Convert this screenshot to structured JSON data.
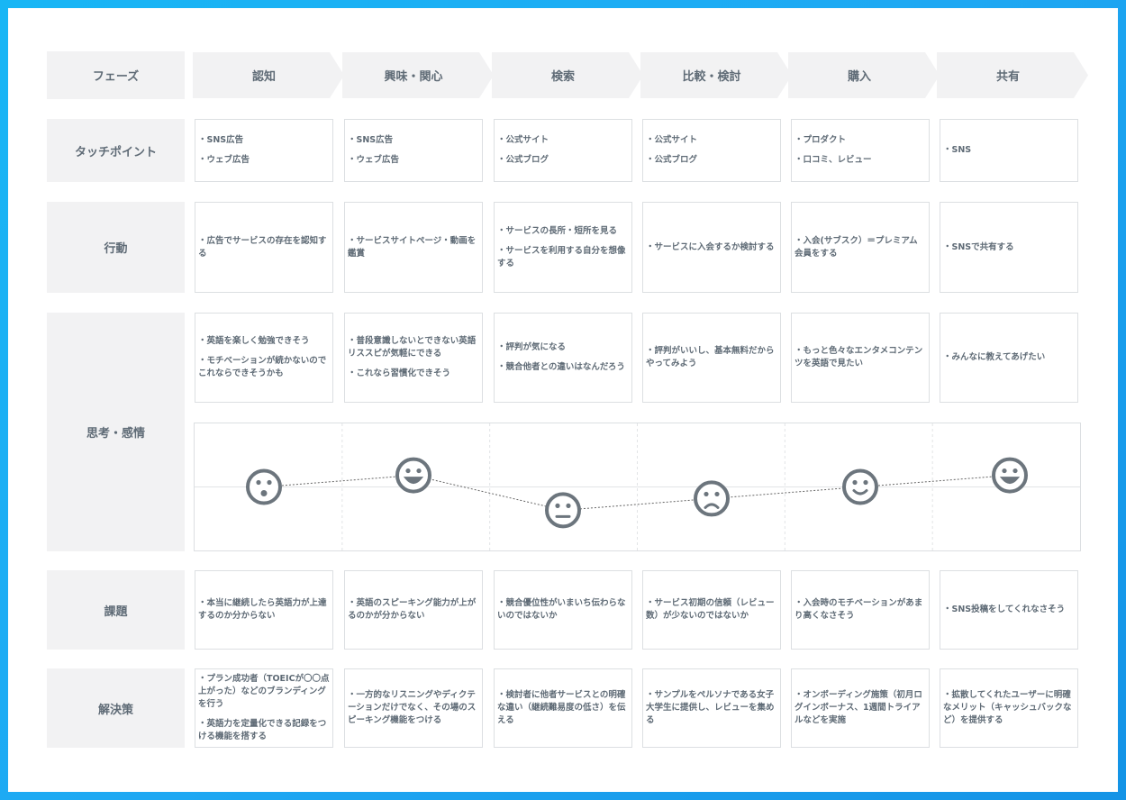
{
  "row_labels": {
    "phase": "フェーズ",
    "touchpoint": "タッチポイント",
    "action": "行動",
    "emotion": "思考・感情",
    "issue": "課題",
    "solution": "解決策"
  },
  "phases": [
    "認知",
    "興味・関心",
    "検索",
    "比較・検討",
    "購入",
    "共有"
  ],
  "touchpoints": [
    [
      "・SNS広告",
      "・ウェブ広告"
    ],
    [
      "・SNS広告",
      "・ウェブ広告"
    ],
    [
      "・公式サイト",
      "・公式ブログ"
    ],
    [
      "・公式サイト",
      "・公式ブログ"
    ],
    [
      "・プロダクト",
      "・口コミ、レビュー"
    ],
    [
      "・SNS"
    ]
  ],
  "actions": [
    [
      "・広告でサービスの存在を認知する"
    ],
    [
      "・サービスサイトページ・動画を鑑賞"
    ],
    [
      "・サービスの長所・短所を見る",
      "・サービスを利用する自分を想像する"
    ],
    [
      "・サービスに入会するか検討する"
    ],
    [
      "・入会(サブスク）＝プレミアム会員をする"
    ],
    [
      "・SNSで共有する"
    ]
  ],
  "thoughts": [
    [
      "・英語を楽しく勉強できそう",
      "・モチベーションが続かないのでこれならできそうかも"
    ],
    [
      "・普段意識しないとできない英語リススピが気軽にできる",
      "・これなら習慣化できそう"
    ],
    [
      "・評判が気になる",
      "・競合他者との違いはなんだろう"
    ],
    [
      "・評判がいいし、基本無料だからやってみよう"
    ],
    [
      "・もっと色々なエンタメコンテンツを英語で見たい"
    ],
    [
      "・みんなに教えてあげたい"
    ]
  ],
  "issues": [
    [
      "・本当に継続したら英語力が上達するのか分からない"
    ],
    [
      "・英語のスピーキング能力が上がるのかが分からない"
    ],
    [
      "・競合優位性がいまいち伝わらないのではないか"
    ],
    [
      "・サービス初期の信頼（レビュー数）が少ないのではないか"
    ],
    [
      "・入会時のモチベーションがあまり高くなさそう"
    ],
    [
      "・SNS投稿をしてくれなさそう"
    ]
  ],
  "solutions": [
    [
      "・プラン成功者（TOEICが〇〇点上がった）などのブランディングを行う",
      "・英語力を定量化できる記録をつける機能を搭する"
    ],
    [
      "・一方的なリスニングやディクテーションだけでなく、その場のスピーキング機能をつける"
    ],
    [
      "・検討者に他者サービスとの明確な違い（継続難易度の低さ）を伝える"
    ],
    [
      "・サンプルをペルソナである女子大学生に提供し、レビューを集める"
    ],
    [
      "・オンボーディング施策（初月ログインボーナス、1週間トライアルなどを実施"
    ],
    [
      "・拡散してくれたユーザーに明確なメリット（キャッシュバックなど）を提供する"
    ]
  ],
  "chart_data": {
    "type": "line",
    "categories": [
      "認知",
      "興味・関心",
      "検索",
      "比較・検討",
      "購入",
      "共有"
    ],
    "values": [
      0,
      1,
      -2,
      -1,
      0,
      1
    ],
    "faces": [
      "surprised-face-icon",
      "happy-face-icon",
      "neutral-face-icon",
      "sad-face-icon",
      "smile-face-icon",
      "happy-face-icon"
    ],
    "ylim": [
      -3,
      3
    ],
    "grid": true,
    "colors": {
      "face": "#6c757d",
      "line": "#666666",
      "grid": "#e2e4e6"
    }
  }
}
